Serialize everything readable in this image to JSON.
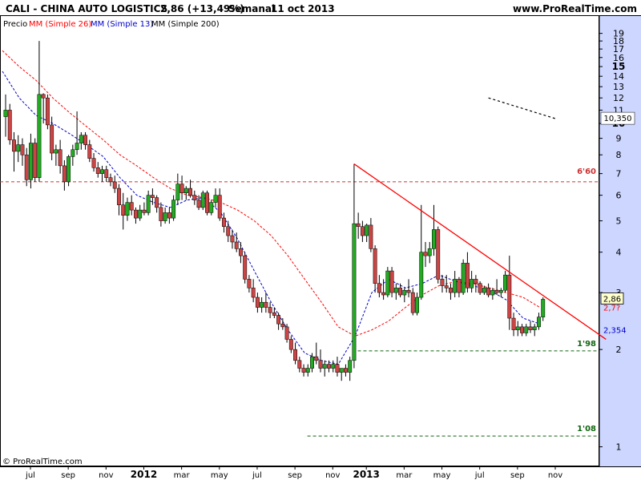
{
  "header": {
    "ticker": "CALI - CHINA AUTO LOGISTICS",
    "price_change": "2,86 (+13,49%)",
    "period": "Semanal",
    "date": "11 oct 2013",
    "site": "www.ProRealTime.com",
    "legend_price": "Precio",
    "legend_mm26": "MM (Simple 26)",
    "legend_mm13": "MM (Simple 13)",
    "legend_mm200": "MM (Simple 200)"
  },
  "footer": {
    "copyright": "© ProRealTime.com"
  },
  "colors": {
    "up": "#22aa22",
    "down": "#cc4444",
    "mm26": "#ff0000",
    "mm13": "#0000cc",
    "axis_bg": "#ccd6ff",
    "resistance": "#cc3333",
    "support": "#116611",
    "trendline": "#ff0000",
    "projection": "#000000"
  },
  "chart_data": {
    "type": "candlestick",
    "title": "CALI - CHINA AUTO LOGISTICS",
    "y_scale": "log",
    "ylim": [
      0.87,
      21.5
    ],
    "y_ticks": [
      1,
      2,
      3,
      4,
      5,
      6,
      7,
      8,
      9,
      10,
      11,
      12,
      13,
      14,
      15,
      16,
      17,
      18,
      19
    ],
    "y_bold_ticks": [
      10,
      15
    ],
    "x_labels": [
      "jul",
      "sep",
      "nov",
      "2012",
      "mar",
      "may",
      "jul",
      "sep",
      "nov",
      "2013",
      "mar",
      "may",
      "jul",
      "sep",
      "nov"
    ],
    "x_label_weeks": [
      0,
      9,
      18,
      27,
      36,
      45,
      54,
      63,
      72,
      80,
      89,
      98,
      107,
      116,
      125
    ],
    "x_bold_labels": [
      "2012",
      "2013"
    ],
    "n_weeks": 148,
    "candle_weeks": [
      [
        0,
        10.5,
        12.3,
        9.1,
        11.0
      ],
      [
        1,
        11.0,
        11.5,
        8.6,
        8.9
      ],
      [
        2,
        8.9,
        9.4,
        7.1,
        8.2
      ],
      [
        3,
        8.2,
        9.2,
        7.6,
        8.6
      ],
      [
        4,
        8.6,
        9.0,
        7.4,
        8.0
      ],
      [
        5,
        8.0,
        8.4,
        6.4,
        6.7
      ],
      [
        6,
        6.7,
        9.3,
        6.3,
        8.7
      ],
      [
        7,
        8.7,
        9.0,
        6.6,
        6.8
      ],
      [
        8,
        6.8,
        18.0,
        6.6,
        12.3
      ],
      [
        9,
        12.3,
        12.4,
        10.0,
        12.0
      ],
      [
        10,
        12.0,
        12.3,
        9.6,
        9.9
      ],
      [
        11,
        9.9,
        10.5,
        7.7,
        8.1
      ],
      [
        12,
        8.1,
        8.6,
        7.4,
        8.3
      ],
      [
        13,
        8.3,
        8.9,
        7.0,
        7.4
      ],
      [
        14,
        7.4,
        7.7,
        6.2,
        6.6
      ],
      [
        15,
        6.6,
        8.0,
        6.4,
        7.9
      ],
      [
        16,
        7.9,
        8.6,
        7.4,
        8.3
      ],
      [
        17,
        8.3,
        10.9,
        8.0,
        8.7
      ],
      [
        18,
        8.7,
        9.4,
        8.3,
        9.2
      ],
      [
        19,
        9.2,
        9.4,
        8.3,
        8.6
      ],
      [
        20,
        8.6,
        8.9,
        7.6,
        7.8
      ],
      [
        21,
        7.8,
        8.1,
        7.1,
        7.3
      ],
      [
        22,
        7.3,
        7.6,
        6.8,
        7.0
      ],
      [
        23,
        7.0,
        7.4,
        6.6,
        7.2
      ],
      [
        24,
        7.2,
        7.4,
        6.6,
        6.8
      ],
      [
        25,
        6.8,
        7.0,
        6.4,
        6.6
      ],
      [
        26,
        6.6,
        6.9,
        6.1,
        6.3
      ],
      [
        27,
        6.3,
        6.5,
        5.2,
        5.6
      ],
      [
        28,
        5.6,
        6.1,
        4.7,
        5.2
      ],
      [
        29,
        5.2,
        5.9,
        5.0,
        5.7
      ],
      [
        30,
        5.7,
        6.0,
        5.2,
        5.4
      ],
      [
        31,
        5.4,
        5.5,
        4.9,
        5.1
      ],
      [
        32,
        5.1,
        5.6,
        5.0,
        5.4
      ],
      [
        33,
        5.4,
        5.7,
        5.2,
        5.3
      ],
      [
        34,
        5.3,
        6.2,
        5.2,
        6.0
      ],
      [
        35,
        6.0,
        6.3,
        5.6,
        5.9
      ],
      [
        36,
        5.9,
        6.0,
        5.3,
        5.5
      ],
      [
        37,
        5.5,
        5.7,
        4.8,
        5.0
      ],
      [
        38,
        5.0,
        5.5,
        4.9,
        5.3
      ],
      [
        39,
        5.3,
        5.5,
        4.9,
        5.1
      ],
      [
        40,
        5.1,
        6.0,
        5.0,
        5.8
      ],
      [
        41,
        5.8,
        7.0,
        5.6,
        6.5
      ],
      [
        42,
        6.5,
        6.9,
        5.8,
        6.1
      ],
      [
        43,
        6.1,
        6.4,
        5.8,
        6.3
      ],
      [
        44,
        6.3,
        6.7,
        5.9,
        6.0
      ],
      [
        45,
        6.0,
        6.2,
        5.6,
        5.8
      ],
      [
        46,
        5.8,
        6.0,
        5.4,
        5.5
      ],
      [
        47,
        5.5,
        6.2,
        5.4,
        6.1
      ],
      [
        48,
        6.1,
        6.2,
        5.2,
        5.3
      ],
      [
        49,
        5.3,
        5.8,
        5.2,
        5.7
      ],
      [
        50,
        5.7,
        6.3,
        5.5,
        6.0
      ],
      [
        51,
        6.0,
        6.3,
        5.0,
        5.1
      ],
      [
        52,
        5.1,
        5.3,
        4.6,
        4.8
      ],
      [
        53,
        4.8,
        5.0,
        4.3,
        4.5
      ],
      [
        54,
        4.5,
        4.7,
        4.1,
        4.3
      ],
      [
        55,
        4.3,
        4.6,
        4.0,
        4.1
      ],
      [
        56,
        4.1,
        4.3,
        3.7,
        3.9
      ],
      [
        57,
        3.9,
        4.0,
        3.2,
        3.3
      ],
      [
        58,
        3.3,
        3.4,
        3.0,
        3.1
      ],
      [
        59,
        3.1,
        3.3,
        2.8,
        2.9
      ],
      [
        60,
        2.9,
        3.0,
        2.6,
        2.7
      ],
      [
        61,
        2.7,
        2.9,
        2.6,
        2.8
      ],
      [
        62,
        2.8,
        3.0,
        2.6,
        2.7
      ],
      [
        63,
        2.7,
        2.8,
        2.5,
        2.6
      ],
      [
        64,
        2.6,
        2.7,
        2.5,
        2.55
      ],
      [
        65,
        2.55,
        2.6,
        2.3,
        2.4
      ],
      [
        66,
        2.4,
        2.5,
        2.3,
        2.35
      ],
      [
        67,
        2.35,
        2.4,
        2.1,
        2.15
      ],
      [
        68,
        2.15,
        2.2,
        1.95,
        2.0
      ],
      [
        69,
        2.0,
        2.1,
        1.8,
        1.85
      ],
      [
        70,
        1.85,
        1.9,
        1.7,
        1.75
      ],
      [
        71,
        1.75,
        1.8,
        1.65,
        1.7
      ],
      [
        72,
        1.7,
        1.8,
        1.65,
        1.75
      ],
      [
        73,
        1.75,
        1.95,
        1.7,
        1.9
      ],
      [
        74,
        1.9,
        2.1,
        1.8,
        1.85
      ],
      [
        75,
        1.85,
        2.0,
        1.7,
        1.75
      ],
      [
        76,
        1.75,
        1.85,
        1.65,
        1.8
      ],
      [
        77,
        1.8,
        1.85,
        1.7,
        1.75
      ],
      [
        78,
        1.75,
        1.85,
        1.7,
        1.8
      ],
      [
        79,
        1.8,
        1.9,
        1.65,
        1.7
      ],
      [
        80,
        1.7,
        1.75,
        1.6,
        1.75
      ],
      [
        81,
        1.75,
        1.8,
        1.65,
        1.7
      ],
      [
        82,
        1.7,
        1.9,
        1.6,
        1.85
      ],
      [
        83,
        1.85,
        7.5,
        1.75,
        4.9
      ],
      [
        84,
        4.9,
        5.3,
        4.4,
        4.8
      ],
      [
        85,
        4.8,
        5.0,
        4.3,
        4.5
      ],
      [
        86,
        4.5,
        4.9,
        4.3,
        4.85
      ],
      [
        87,
        4.85,
        5.1,
        4.0,
        4.1
      ],
      [
        88,
        4.1,
        4.2,
        3.0,
        3.2
      ],
      [
        89,
        3.2,
        3.4,
        2.9,
        3.0
      ],
      [
        90,
        3.0,
        3.3,
        2.85,
        2.95
      ],
      [
        91,
        2.95,
        3.6,
        2.9,
        3.5
      ],
      [
        92,
        3.5,
        3.6,
        2.9,
        3.0
      ],
      [
        93,
        3.0,
        3.2,
        2.85,
        3.1
      ],
      [
        94,
        3.1,
        3.2,
        2.9,
        2.95
      ],
      [
        95,
        2.95,
        3.1,
        2.8,
        3.05
      ],
      [
        96,
        3.05,
        3.3,
        2.9,
        3.0
      ],
      [
        97,
        3.0,
        3.1,
        2.55,
        2.6
      ],
      [
        98,
        2.6,
        3.0,
        2.55,
        2.9
      ],
      [
        99,
        2.9,
        5.6,
        2.85,
        4.0
      ],
      [
        100,
        4.0,
        4.3,
        3.6,
        3.9
      ],
      [
        101,
        3.9,
        4.3,
        3.7,
        4.1
      ],
      [
        102,
        4.1,
        5.6,
        3.9,
        4.7
      ],
      [
        103,
        4.7,
        4.8,
        3.2,
        3.3
      ],
      [
        104,
        3.3,
        3.4,
        3.0,
        3.15
      ],
      [
        105,
        3.15,
        3.4,
        3.0,
        3.1
      ],
      [
        106,
        3.1,
        3.2,
        2.85,
        3.0
      ],
      [
        107,
        3.0,
        3.5,
        2.9,
        3.3
      ],
      [
        108,
        3.3,
        3.35,
        2.9,
        3.0
      ],
      [
        109,
        3.0,
        3.8,
        2.95,
        3.7
      ],
      [
        110,
        3.7,
        4.0,
        3.0,
        3.1
      ],
      [
        111,
        3.1,
        3.5,
        3.0,
        3.3
      ],
      [
        112,
        3.3,
        3.4,
        3.0,
        3.2
      ],
      [
        113,
        3.2,
        3.25,
        2.95,
        3.0
      ],
      [
        114,
        3.0,
        3.15,
        2.95,
        3.1
      ],
      [
        115,
        3.1,
        3.2,
        2.9,
        2.95
      ],
      [
        116,
        2.95,
        3.1,
        2.85,
        3.05
      ],
      [
        117,
        3.05,
        3.3,
        2.95,
        3.0
      ],
      [
        118,
        3.0,
        3.1,
        2.9,
        3.05
      ],
      [
        119,
        3.05,
        3.5,
        3.0,
        3.4
      ],
      [
        120,
        3.4,
        3.9,
        2.3,
        2.5
      ],
      [
        121,
        2.5,
        2.6,
        2.2,
        2.3
      ],
      [
        122,
        2.3,
        2.45,
        2.2,
        2.35
      ],
      [
        123,
        2.35,
        2.4,
        2.2,
        2.25
      ],
      [
        124,
        2.25,
        2.4,
        2.2,
        2.35
      ],
      [
        125,
        2.35,
        2.45,
        2.25,
        2.3
      ],
      [
        126,
        2.3,
        2.4,
        2.2,
        2.35
      ],
      [
        127,
        2.35,
        2.6,
        2.3,
        2.52
      ],
      [
        128,
        2.52,
        2.9,
        2.45,
        2.86
      ]
    ],
    "candle_columns": [
      "week",
      "open",
      "high",
      "low",
      "close"
    ],
    "sma26_path": [
      [
        0,
        16.8
      ],
      [
        4,
        15.0
      ],
      [
        8,
        13.6
      ],
      [
        12,
        12.0
      ],
      [
        16,
        10.8
      ],
      [
        20,
        9.8
      ],
      [
        24,
        8.9
      ],
      [
        28,
        8.0
      ],
      [
        32,
        7.4
      ],
      [
        36,
        6.8
      ],
      [
        40,
        6.3
      ],
      [
        44,
        6.0
      ],
      [
        48,
        5.9
      ],
      [
        52,
        5.7
      ],
      [
        56,
        5.4
      ],
      [
        60,
        5.0
      ],
      [
        64,
        4.5
      ],
      [
        68,
        3.9
      ],
      [
        72,
        3.3
      ],
      [
        76,
        2.8
      ],
      [
        80,
        2.35
      ],
      [
        84,
        2.2
      ],
      [
        88,
        2.3
      ],
      [
        92,
        2.45
      ],
      [
        96,
        2.7
      ],
      [
        100,
        2.95
      ],
      [
        104,
        3.15
      ],
      [
        108,
        3.25
      ],
      [
        112,
        3.2
      ],
      [
        116,
        3.1
      ],
      [
        120,
        3.0
      ],
      [
        124,
        2.9
      ],
      [
        128,
        2.7
      ]
    ],
    "sma13_path": [
      [
        0,
        14.5
      ],
      [
        4,
        12.0
      ],
      [
        8,
        10.6
      ],
      [
        12,
        10.0
      ],
      [
        16,
        9.3
      ],
      [
        20,
        8.6
      ],
      [
        24,
        7.9
      ],
      [
        28,
        6.8
      ],
      [
        32,
        6.0
      ],
      [
        36,
        5.7
      ],
      [
        40,
        5.5
      ],
      [
        44,
        5.8
      ],
      [
        48,
        5.9
      ],
      [
        52,
        5.3
      ],
      [
        56,
        4.4
      ],
      [
        60,
        3.5
      ],
      [
        64,
        2.8
      ],
      [
        68,
        2.3
      ],
      [
        72,
        1.95
      ],
      [
        76,
        1.85
      ],
      [
        80,
        1.8
      ],
      [
        84,
        2.2
      ],
      [
        88,
        3.0
      ],
      [
        92,
        3.3
      ],
      [
        96,
        3.1
      ],
      [
        100,
        3.2
      ],
      [
        104,
        3.4
      ],
      [
        108,
        3.25
      ],
      [
        112,
        3.15
      ],
      [
        116,
        3.05
      ],
      [
        120,
        2.85
      ],
      [
        124,
        2.5
      ],
      [
        128,
        2.4
      ]
    ],
    "resistance_level": 6.6,
    "resistance_label": "6'60",
    "support_levels": [
      {
        "value": 1.98,
        "label": "1'98",
        "from_week": 77
      },
      {
        "value": 1.08,
        "label": "1'08",
        "from_week": 65
      }
    ],
    "trendline": [
      [
        83,
        7.5
      ],
      [
        143,
        2.15
      ]
    ],
    "projection_line": [
      [
        115,
        12.0
      ],
      [
        131,
        10.35
      ]
    ],
    "last_price_label": "2,86",
    "last_price": 2.86,
    "sma_price_labels": [
      {
        "label": "2,7?",
        "value": 2.7
      },
      {
        "label": "2,354",
        "value": 2.354
      }
    ],
    "target_label": "10,350",
    "target_value": 10.35,
    "grid": false
  }
}
